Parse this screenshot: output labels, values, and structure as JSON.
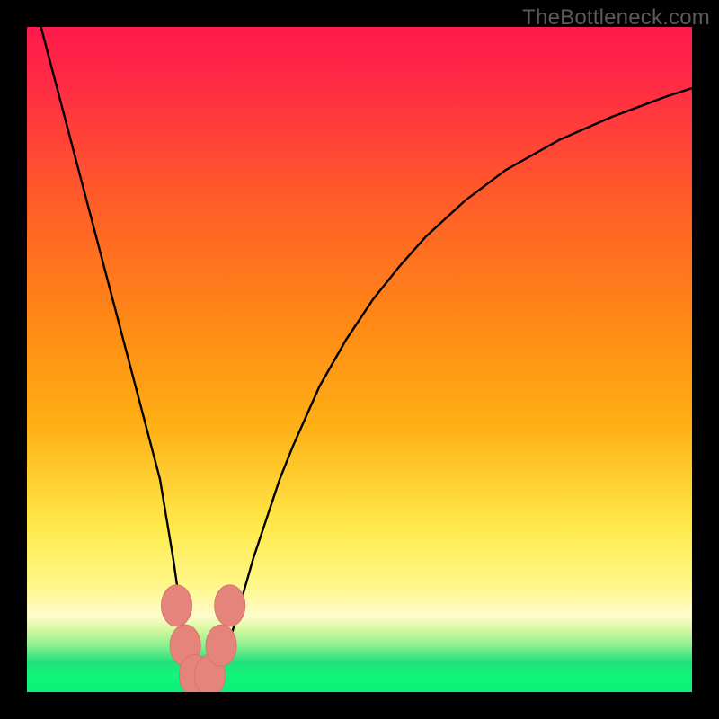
{
  "watermark": "TheBottleneck.com",
  "colors": {
    "black": "#000000",
    "curve": "#000000",
    "marker_fill": "#e4847b",
    "marker_stroke": "#d8766e",
    "grad_top": "#ff1a4b",
    "grad_upper": "#ff5a2a",
    "grad_mid": "#ffb015",
    "grad_lower": "#ffe94a",
    "grad_pale": "#fffccc",
    "grad_green": "#22e07a",
    "grad_green_bright": "#12f57a"
  },
  "chart_data": {
    "type": "line",
    "title": "",
    "xlabel": "",
    "ylabel": "",
    "xlim": [
      0,
      100
    ],
    "ylim": [
      0,
      100
    ],
    "series": [
      {
        "name": "bottleneck-curve",
        "x": [
          0,
          2,
          4,
          6,
          8,
          10,
          12,
          14,
          16,
          18,
          20,
          22,
          23,
          24,
          25,
          26,
          27,
          28,
          29,
          30,
          32,
          34,
          36,
          38,
          40,
          44,
          48,
          52,
          56,
          60,
          66,
          72,
          80,
          88,
          96,
          100
        ],
        "y": [
          108,
          100.4,
          92.8,
          85.2,
          77.6,
          70,
          62.4,
          54.8,
          47.2,
          39.6,
          32,
          20,
          13,
          7,
          3,
          1,
          0.5,
          1,
          3,
          6,
          13,
          20,
          26,
          32,
          37,
          46,
          53,
          59,
          64,
          68.5,
          74,
          78.5,
          83,
          86.5,
          89.5,
          90.8
        ]
      }
    ],
    "markers": [
      {
        "x": 22.5,
        "y": 13,
        "r": 2.3
      },
      {
        "x": 23.8,
        "y": 7,
        "r": 2.3
      },
      {
        "x": 25.2,
        "y": 2.5,
        "r": 2.3
      },
      {
        "x": 27.5,
        "y": 2.5,
        "r": 2.3
      },
      {
        "x": 29.2,
        "y": 7,
        "r": 2.3
      },
      {
        "x": 30.5,
        "y": 13,
        "r": 2.3
      }
    ],
    "gradient_stops": [
      {
        "offset": 0.0,
        "color": "#ff1a4b"
      },
      {
        "offset": 0.08,
        "color": "#ff2a45"
      },
      {
        "offset": 0.25,
        "color": "#ff5a2a"
      },
      {
        "offset": 0.45,
        "color": "#ff8a15"
      },
      {
        "offset": 0.6,
        "color": "#ffb015"
      },
      {
        "offset": 0.75,
        "color": "#ffe94a"
      },
      {
        "offset": 0.84,
        "color": "#fff88a"
      },
      {
        "offset": 0.885,
        "color": "#fffccc"
      },
      {
        "offset": 0.905,
        "color": "#d8f8a0"
      },
      {
        "offset": 0.93,
        "color": "#8cf090"
      },
      {
        "offset": 0.955,
        "color": "#22e07a"
      },
      {
        "offset": 0.975,
        "color": "#12f57a"
      },
      {
        "offset": 1.0,
        "color": "#0af07a"
      }
    ]
  }
}
